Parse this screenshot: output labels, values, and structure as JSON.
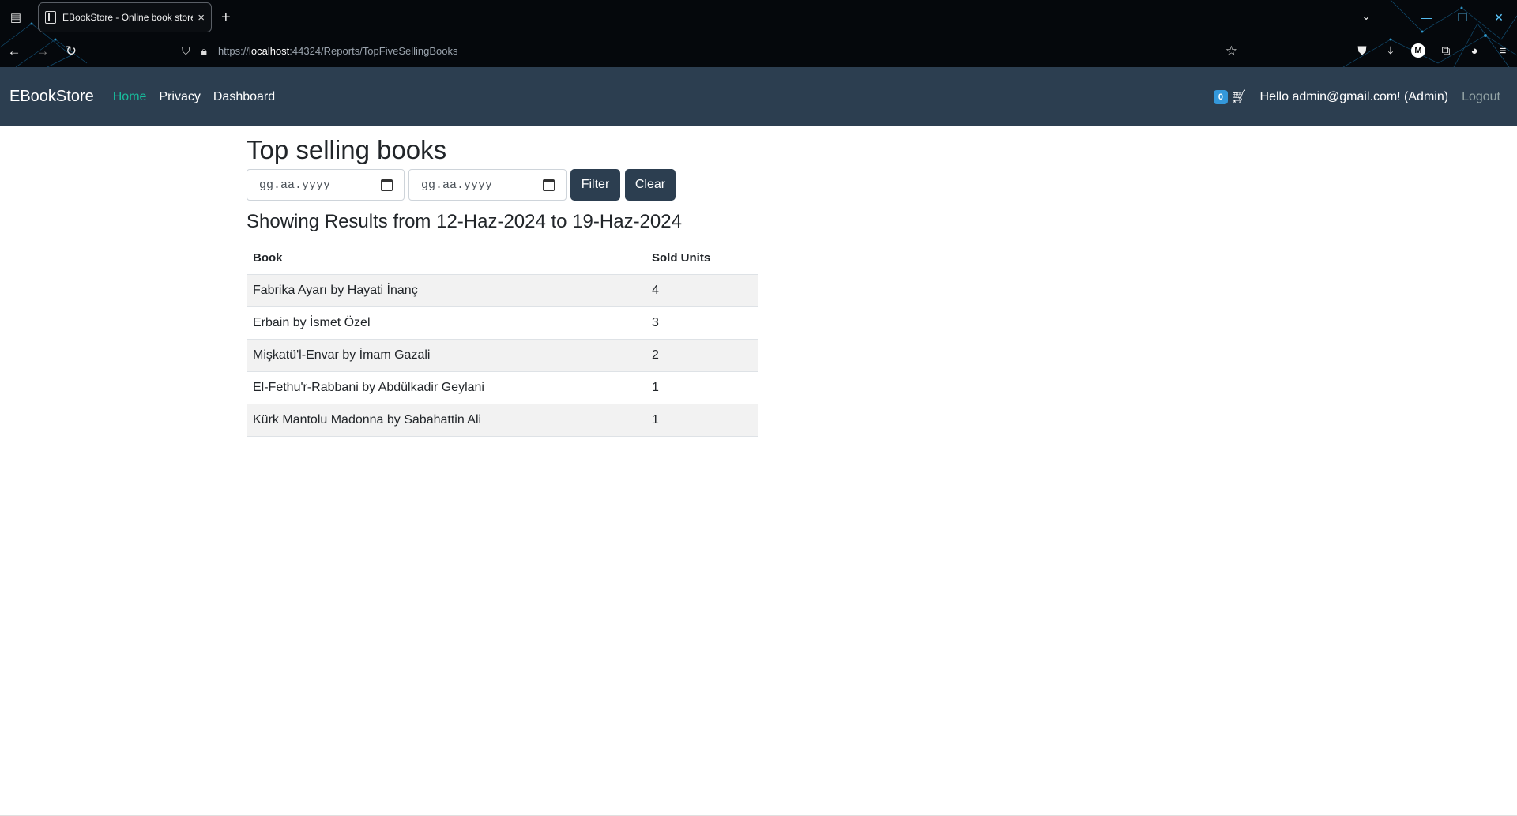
{
  "browser": {
    "tab_title": "EBookStore - Online book store",
    "tab_close": "×",
    "new_tab": "+",
    "url_prefix": "https://",
    "url_host": "localhost",
    "url_rest": ":44324/Reports/TopFiveSellingBooks",
    "icons": [
      "tab-list-icon",
      "back-icon",
      "forward-icon",
      "reload-icon",
      "shield-icon",
      "lock-icon",
      "star-icon",
      "pocket-icon",
      "download-icon",
      "extension-icon",
      "menu-icon"
    ],
    "accent_color": "#5cc8ff"
  },
  "navbar": {
    "brand": "EBookStore",
    "links": [
      {
        "label": "Home",
        "active": true
      },
      {
        "label": "Privacy",
        "active": false
      },
      {
        "label": "Dashboard",
        "active": false
      }
    ],
    "cart_count": "0",
    "hello": "Hello admin@gmail.com! (Admin)",
    "logout": "Logout",
    "bg_color": "#2c3e50",
    "active_color": "#18bc9c"
  },
  "main": {
    "title": "Top selling books",
    "date_from_placeholder": "gg.aa.yyyy",
    "date_to_placeholder": "gg.aa.yyyy",
    "filter_label": "Filter",
    "clear_label": "Clear",
    "results_text": "Showing Results from 12-Haz-2024 to 19-Haz-2024",
    "table": {
      "headers": [
        "Book",
        "Sold Units"
      ],
      "rows": [
        [
          "Fabrika Ayarı by Hayati İnanç",
          "4"
        ],
        [
          "Erbain by İsmet Özel",
          "3"
        ],
        [
          "Mişkatü'l-Envar by İmam Gazali",
          "2"
        ],
        [
          "El-Fethu'r-Rabbani by Abdülkadir Geylani",
          "1"
        ],
        [
          "Kürk Mantolu Madonna by Sabahattin Ali",
          "1"
        ]
      ]
    }
  }
}
